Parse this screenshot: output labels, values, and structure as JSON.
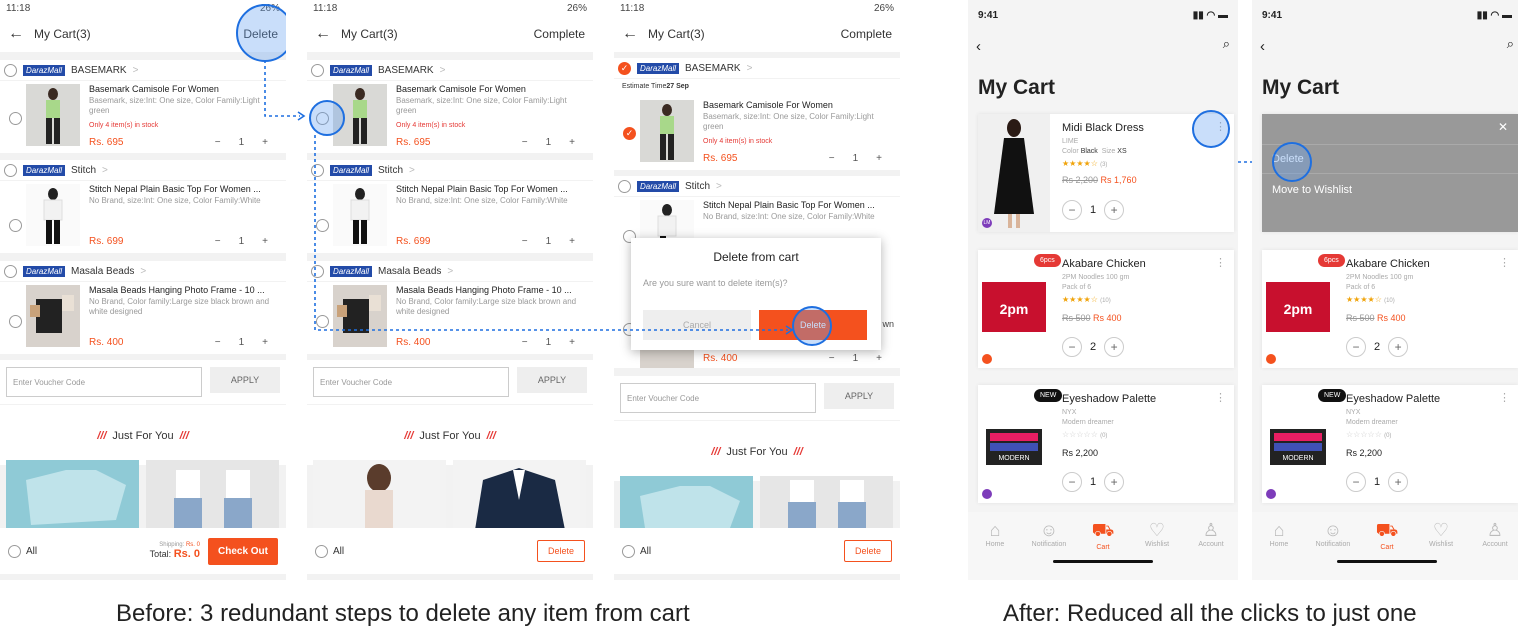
{
  "before": {
    "phones": [
      {
        "status_time": "11:18",
        "status_battery": "26%",
        "header_title": "My Cart(3)",
        "header_action": "Delete"
      },
      {
        "status_time": "11:18",
        "status_battery": "26%",
        "header_title": "My Cart(3)",
        "header_action": "Complete"
      },
      {
        "status_time": "11:18",
        "status_battery": "26%",
        "header_title": "My Cart(3)",
        "header_action": "Complete"
      }
    ],
    "shops": [
      {
        "badge": "DarazMall",
        "name": "BASEMARK"
      },
      {
        "badge": "DarazMall",
        "name": "Stitch"
      },
      {
        "badge": "DarazMall",
        "name": "Masala Beads"
      }
    ],
    "items": [
      {
        "name": "Basemark Camisole For Women",
        "desc": "Basemark, size:Int: One size, Color Family:Light green",
        "stock": "Only 4 item(s) in stock",
        "price": "Rs. 695",
        "qty": "1"
      },
      {
        "name": "Stitch Nepal Plain Basic Top For Women ...",
        "desc": "No Brand, size:Int: One size, Color Family:White",
        "price": "Rs. 699",
        "qty": "1"
      },
      {
        "name": "Masala Beads Hanging Photo Frame - 10 ...",
        "desc": "No Brand, Color family:Large size black brown and white designed",
        "price": "Rs. 400",
        "qty": "1"
      }
    ],
    "estimate_label": "Estimate Time",
    "estimate_date": "27 Sep",
    "voucher_placeholder": "Enter Voucher Code",
    "apply_label": "APPLY",
    "just_for_you": "Just For You",
    "all_label": "All",
    "shipping_label": "Shipping:",
    "shipping_value": "Rs. 0",
    "total_label": "Total:",
    "total_value": "Rs. 0",
    "checkout_label": "Check Out",
    "delete_label": "Delete",
    "dialog": {
      "title": "Delete from cart",
      "message": "Are you sure want to delete item(s)?",
      "cancel": "Cancel",
      "confirm": "Delete"
    },
    "partial_text": "wn",
    "caption": "Before: 3 redundant steps to delete any item from cart"
  },
  "after": {
    "status_time": "9:41",
    "title": "My Cart",
    "cards": [
      {
        "name": "Midi Black Dress",
        "brand": "LIME",
        "color_label": "Color",
        "color": "Black",
        "size_label": "Size",
        "size": "XS",
        "rating_count": "(3)",
        "old_price": "Rs 2,200",
        "price": "Rs 1,760",
        "qty": "1"
      },
      {
        "tag": "6pcs",
        "name": "Akabare Chicken",
        "brand": "2PM Noodles 100 gm",
        "pack": "Pack of 6",
        "rating_count": "(10)",
        "old_price": "Rs 500",
        "price": "Rs 400",
        "qty": "2"
      },
      {
        "tag": "NEW",
        "name": "Eyeshadow Palette",
        "brand": "NYX",
        "variant": "Modern dreamer",
        "rating_count": "(0)",
        "price": "Rs 2,200",
        "qty": "1"
      }
    ],
    "menu": {
      "delete": "Delete",
      "wishlist": "Move to Wishlist",
      "close": "✕"
    },
    "tabs": [
      {
        "label": "Home",
        "icon": "home-icon"
      },
      {
        "label": "Notification",
        "icon": "notification-icon"
      },
      {
        "label": "Cart",
        "icon": "cart-icon"
      },
      {
        "label": "Wishlist",
        "icon": "heart-icon"
      },
      {
        "label": "Account",
        "icon": "account-icon"
      }
    ],
    "palette_text": "MODERN",
    "palette_sub": "dreamer",
    "noodle_text": "2pm",
    "caption": "After: Reduced all the clicks to just one"
  },
  "colors": {
    "accent": "#f4511e",
    "daraz": "#234ba8",
    "highlight": "#1e6fe0"
  }
}
